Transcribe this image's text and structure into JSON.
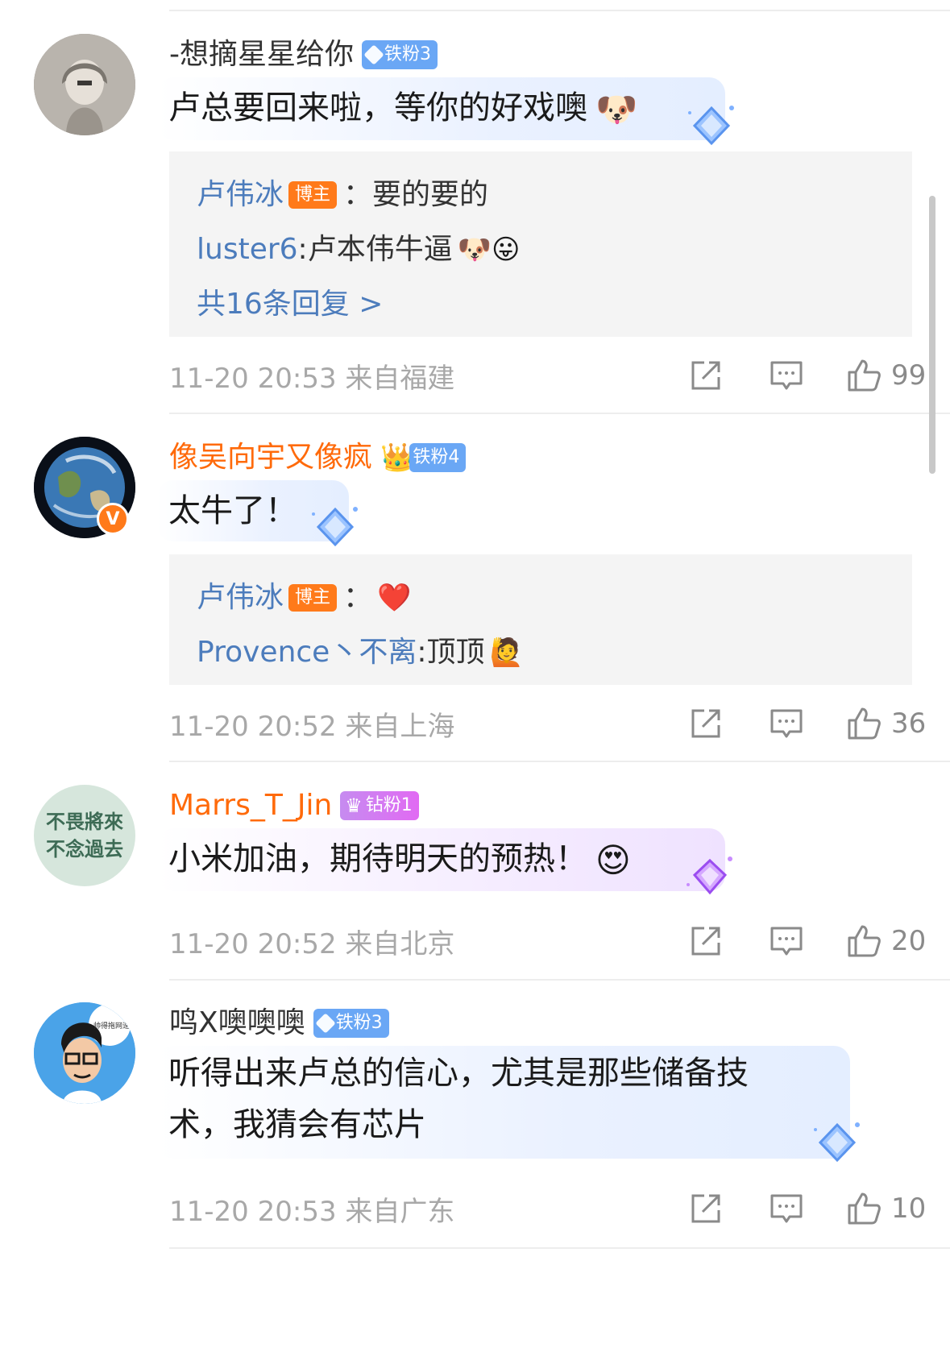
{
  "comments": [
    {
      "username": "-想摘星星给你",
      "badge": "铁粉3",
      "text": "卢总要回来啦，等你的好戏噢",
      "emoji": "🐶",
      "replies": [
        {
          "name": "卢伟冰",
          "is_host": true,
          "host_label": "博主",
          "sep": "：",
          "text": "要的要的",
          "emoji": ""
        },
        {
          "name": "luster6",
          "is_host": false,
          "sep": ": ",
          "text": "卢本伟牛逼",
          "emoji": "🐶😛"
        }
      ],
      "more_replies": "共16条回复 >",
      "time": "11-20 20:53 来自福建",
      "likes": "99"
    },
    {
      "username": "像吴向宇又像疯",
      "badge": "铁粉4",
      "crown": "👑",
      "text": "太牛了！",
      "replies": [
        {
          "name": "卢伟冰",
          "is_host": true,
          "host_label": "博主",
          "sep": "：",
          "text": "",
          "emoji": "❤️"
        },
        {
          "name": "Provence丶不离",
          "is_host": false,
          "sep": ": ",
          "text": "顶顶",
          "emoji": "🙋"
        }
      ],
      "time": "11-20 20:52 来自上海",
      "likes": "36"
    },
    {
      "username": "Marrs_T_Jin",
      "badge": "钻粉1",
      "text": "小米加油，期待明天的预热！",
      "emoji": "😍",
      "avatar_text_1": "不畏將來",
      "avatar_text_2": "不念過去",
      "time": "11-20 20:52 来自北京",
      "likes": "20"
    },
    {
      "username": "鸣X噢噢噢",
      "badge": "铁粉3",
      "avatar_text": "帅得拖网速",
      "text_line1": "听得出来卢总的信心，尤其是那些储备技",
      "text_line2": "术，我猜会有芯片",
      "time": "11-20 20:53 来自广东",
      "likes": "10"
    }
  ],
  "colors": {
    "accent_orange": "#ff6a0a",
    "reply_blue": "#4c7cbc",
    "meta_gray": "#a8a8a8"
  },
  "icons": [
    "repost-icon",
    "comment-icon",
    "like-icon"
  ]
}
